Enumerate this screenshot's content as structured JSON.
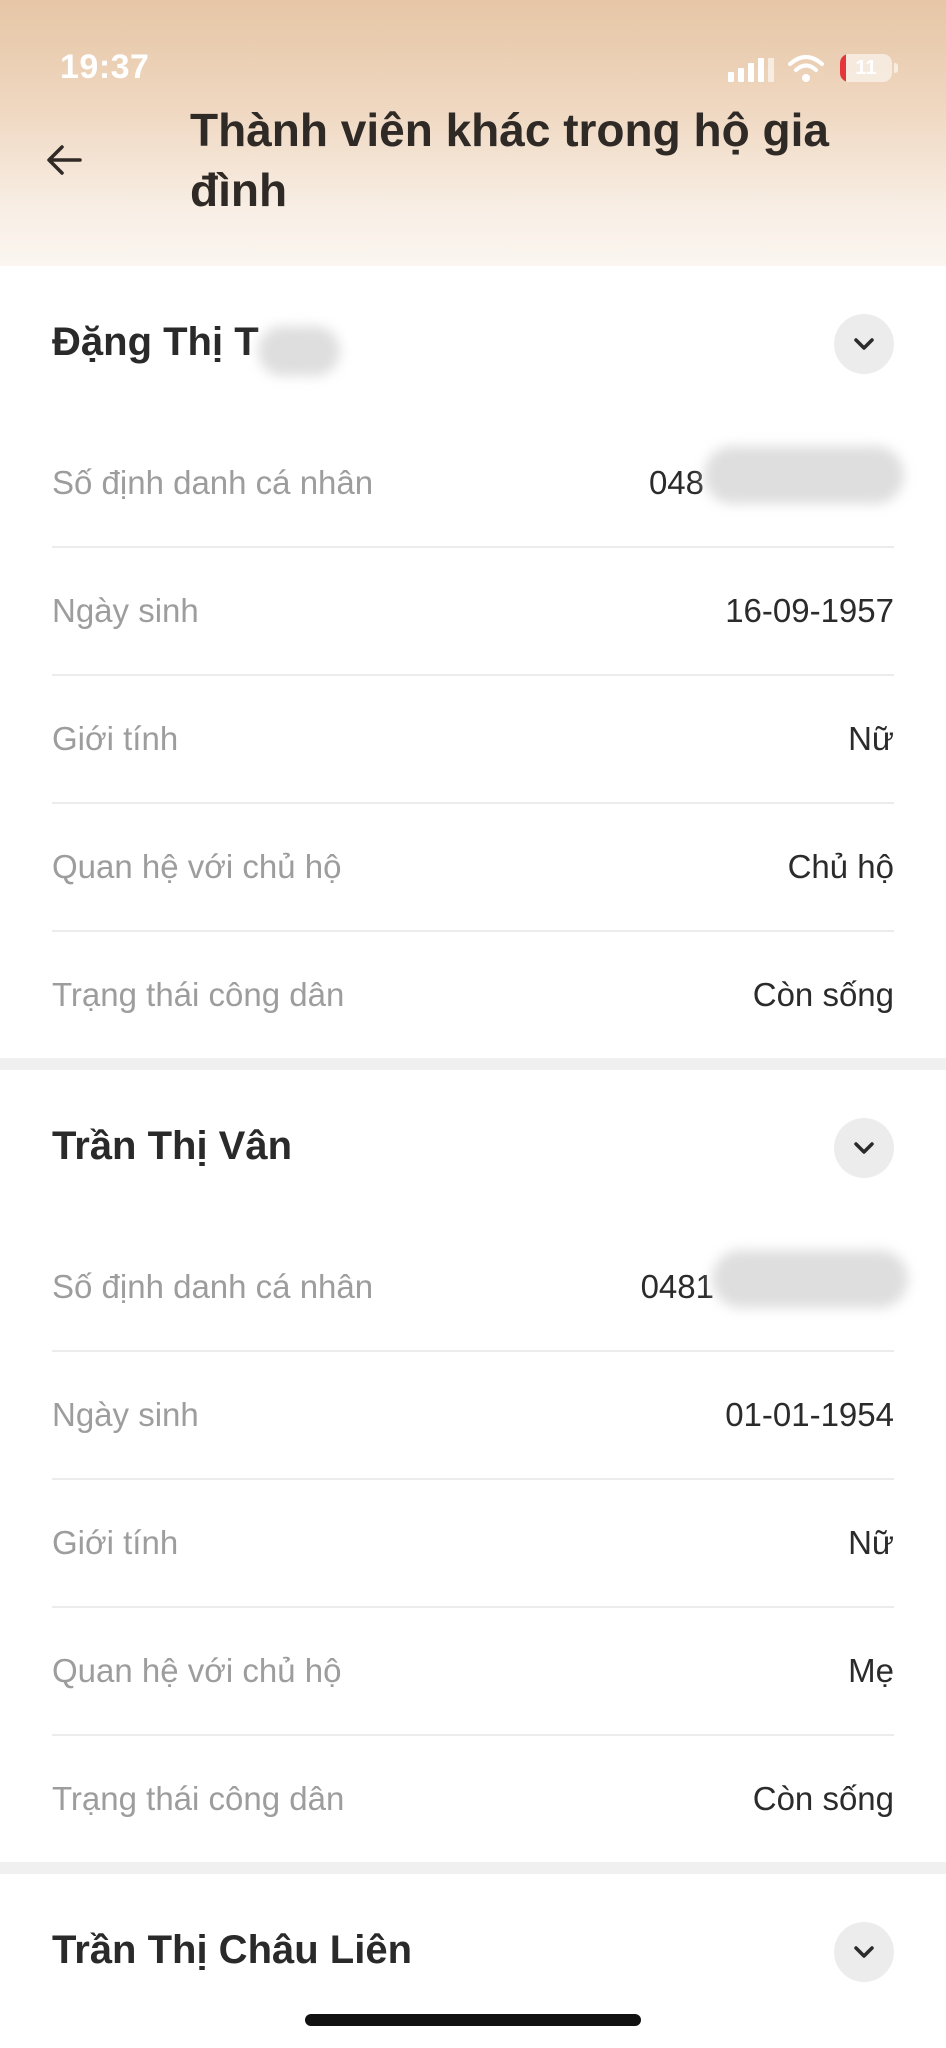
{
  "status_bar": {
    "time": "19:37",
    "battery": "11"
  },
  "header": {
    "title": "Thành viên khác trong hộ gia đình"
  },
  "members": [
    {
      "name": "Đặng Thị T",
      "rows": [
        {
          "label": "Số định danh cá nhân",
          "value": "048"
        },
        {
          "label": "Ngày sinh",
          "value": "16-09-1957"
        },
        {
          "label": "Giới tính",
          "value": "Nữ"
        },
        {
          "label": "Quan hệ với chủ hộ",
          "value": "Chủ hộ"
        },
        {
          "label": "Trạng thái công dân",
          "value": "Còn sống"
        }
      ]
    },
    {
      "name": "Trần Thị Vân",
      "rows": [
        {
          "label": "Số định danh cá nhân",
          "value": "0481"
        },
        {
          "label": "Ngày sinh",
          "value": "01-01-1954"
        },
        {
          "label": "Giới tính",
          "value": "Nữ"
        },
        {
          "label": "Quan hệ với chủ hộ",
          "value": "Mẹ"
        },
        {
          "label": "Trạng thái công dân",
          "value": "Còn sống"
        }
      ]
    },
    {
      "name": "Trần Thị Châu Liên"
    }
  ]
}
